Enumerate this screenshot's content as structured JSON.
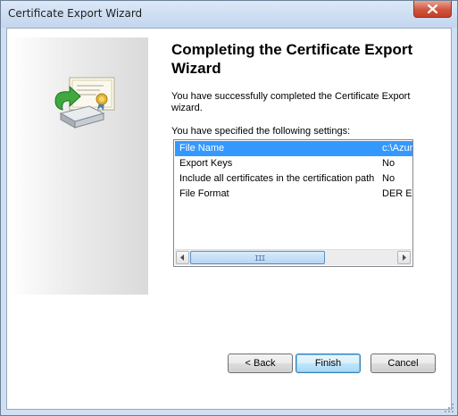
{
  "window": {
    "title": "Certificate Export Wizard"
  },
  "heading": "Completing the Certificate Export Wizard",
  "intro_text": "You have successfully completed the Certificate Export wizard.",
  "settings_label": "You have specified the following settings:",
  "settings": {
    "rows": [
      {
        "name": "File Name",
        "value": "c:\\Azur",
        "selected": true
      },
      {
        "name": "Export Keys",
        "value": "No",
        "selected": false
      },
      {
        "name": "Include all certificates in the certification path",
        "value": "No",
        "selected": false
      },
      {
        "name": "File Format",
        "value": "DER En",
        "selected": false
      }
    ]
  },
  "scrollbar": {
    "grip": "III"
  },
  "buttons": {
    "back": "< Back",
    "finish": "Finish",
    "cancel": "Cancel"
  },
  "colors": {
    "selection": "#3399ff",
    "title_bar": "#c3d6ee",
    "close_button": "#c24025"
  },
  "icons": {
    "close": "close-icon",
    "wizard": "certificate-export-icon",
    "scroll_left": "chevron-left-icon",
    "scroll_right": "chevron-right-icon"
  }
}
